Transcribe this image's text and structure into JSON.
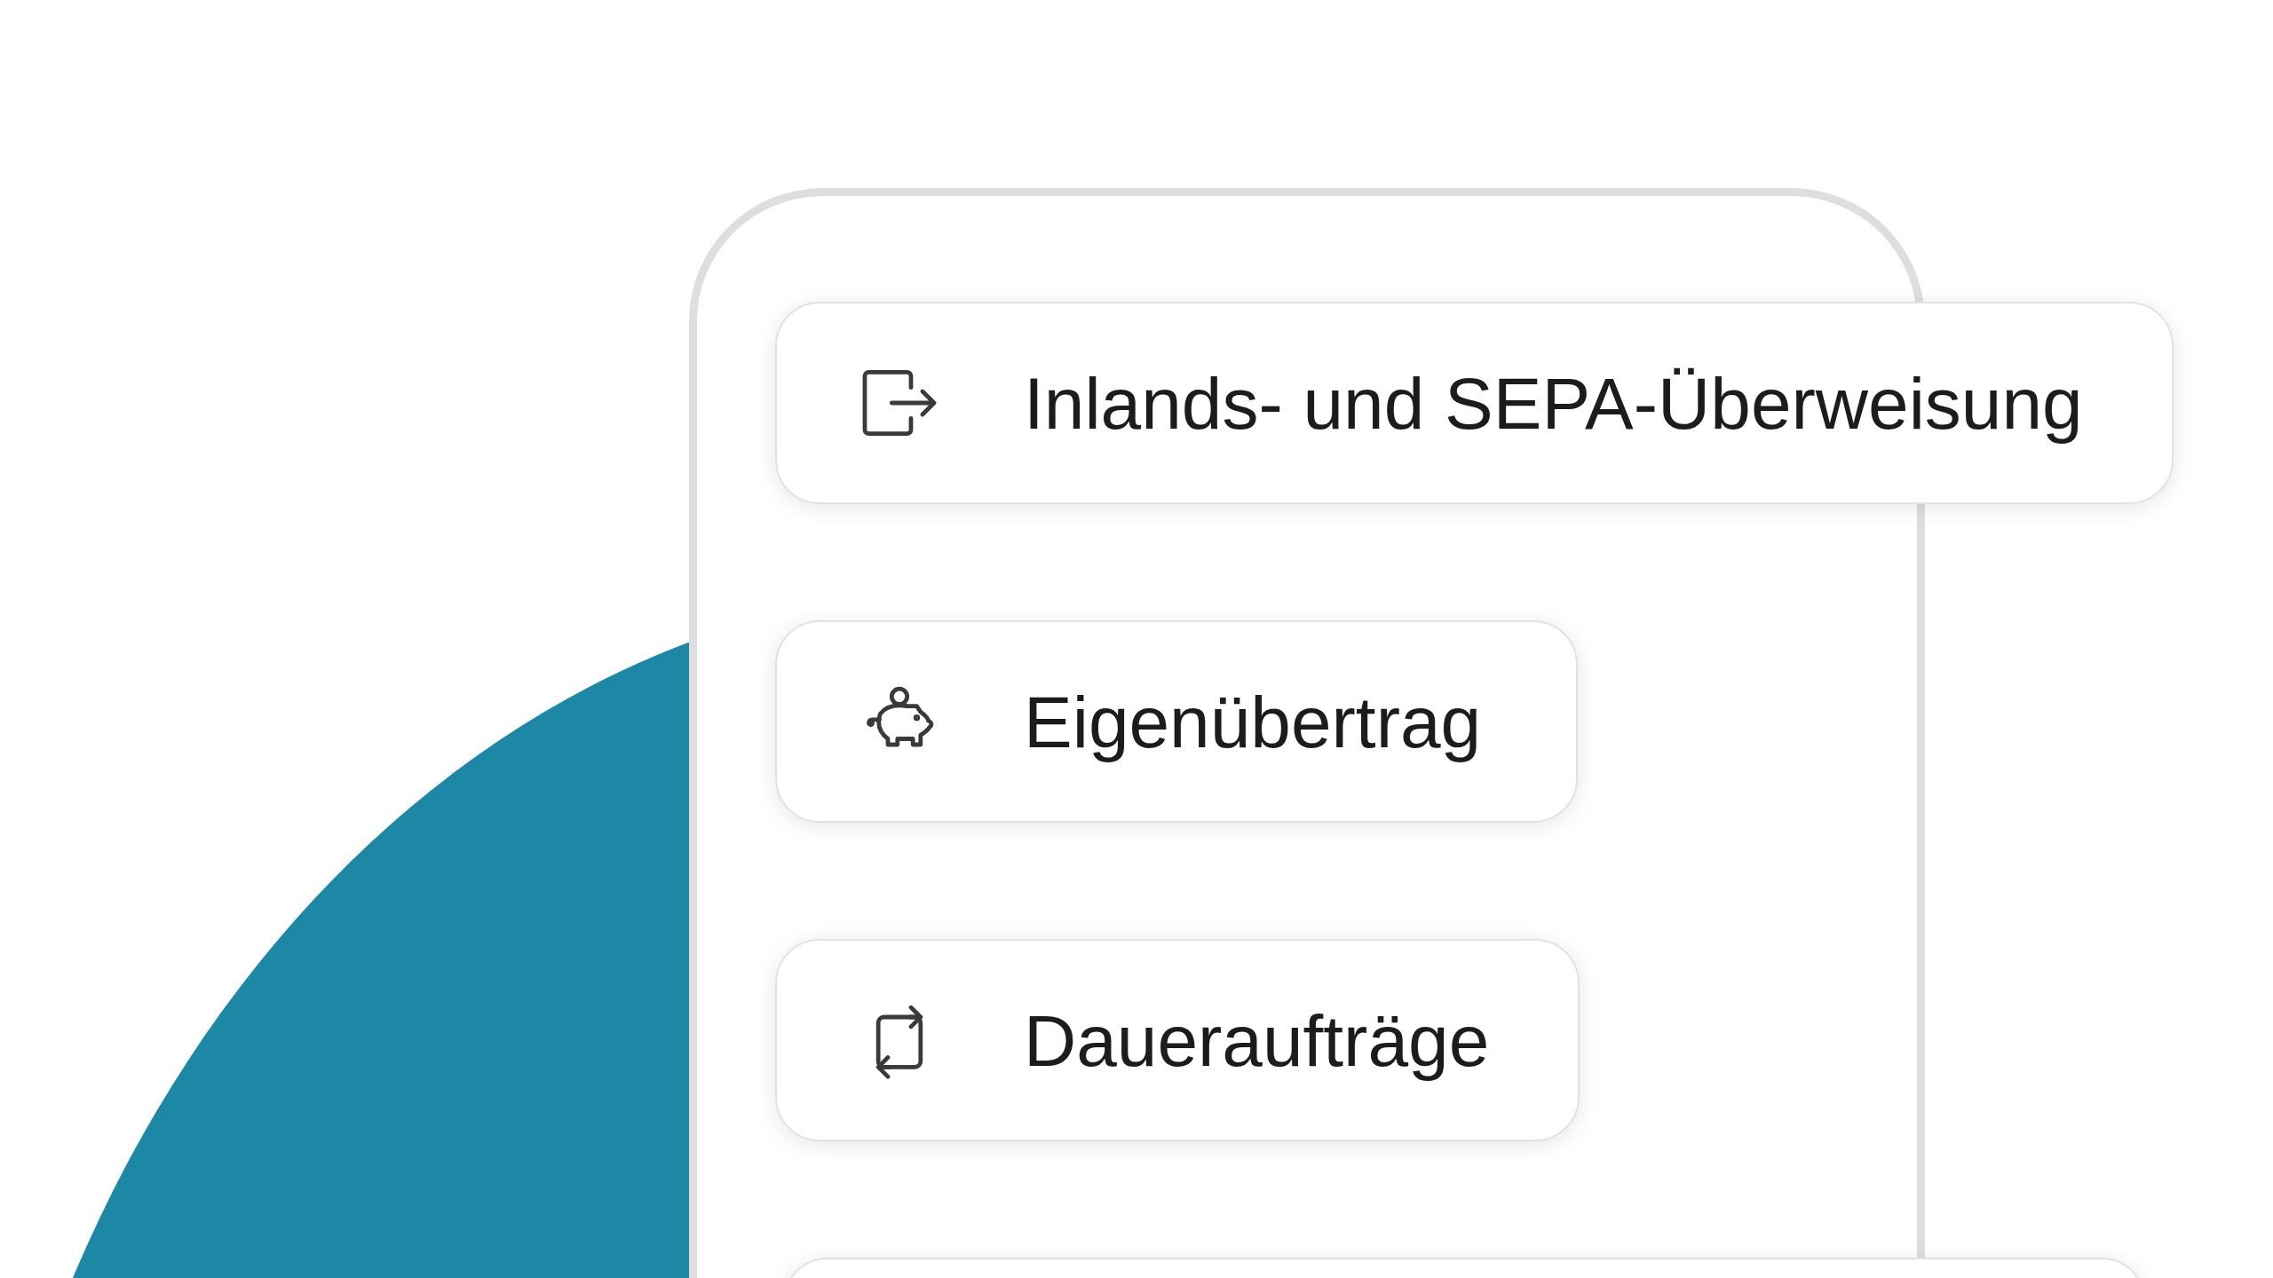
{
  "menu_items": [
    {
      "kind": "transfer",
      "label": "Inlands- und SEPA-Überweisung"
    },
    {
      "kind": "piggy",
      "label": "Eigenübertrag"
    },
    {
      "kind": "repeat",
      "label": "Daueraufträge"
    }
  ]
}
